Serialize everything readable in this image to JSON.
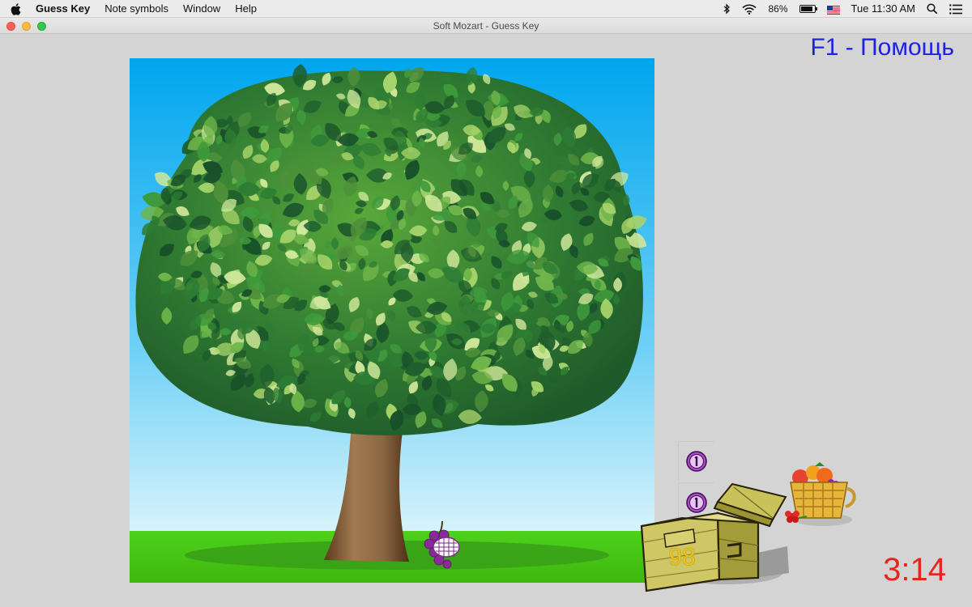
{
  "menubar": {
    "apple_icon": "apple-icon",
    "items": [
      {
        "label": "Guess Key",
        "bold": true
      },
      {
        "label": "Note symbols"
      },
      {
        "label": "Window"
      },
      {
        "label": "Help"
      }
    ],
    "battery_percent": "86%",
    "battery_level": 0.86,
    "clock": "Tue 11:30 AM"
  },
  "window": {
    "title": "Soft Mozart - Guess Key"
  },
  "help_text": "F1 - Помощь",
  "game": {
    "chest_count": "98",
    "timer": "3:14",
    "coins": [
      {
        "symbol": "coin-icon"
      },
      {
        "symbol": "coin-icon"
      }
    ]
  },
  "colors": {
    "help_text": "#1e22e6",
    "timer": "#e8241c",
    "sky_top": "#00a6ef",
    "grass": "#4ccc1a",
    "chest_count": "#f1c40f"
  }
}
